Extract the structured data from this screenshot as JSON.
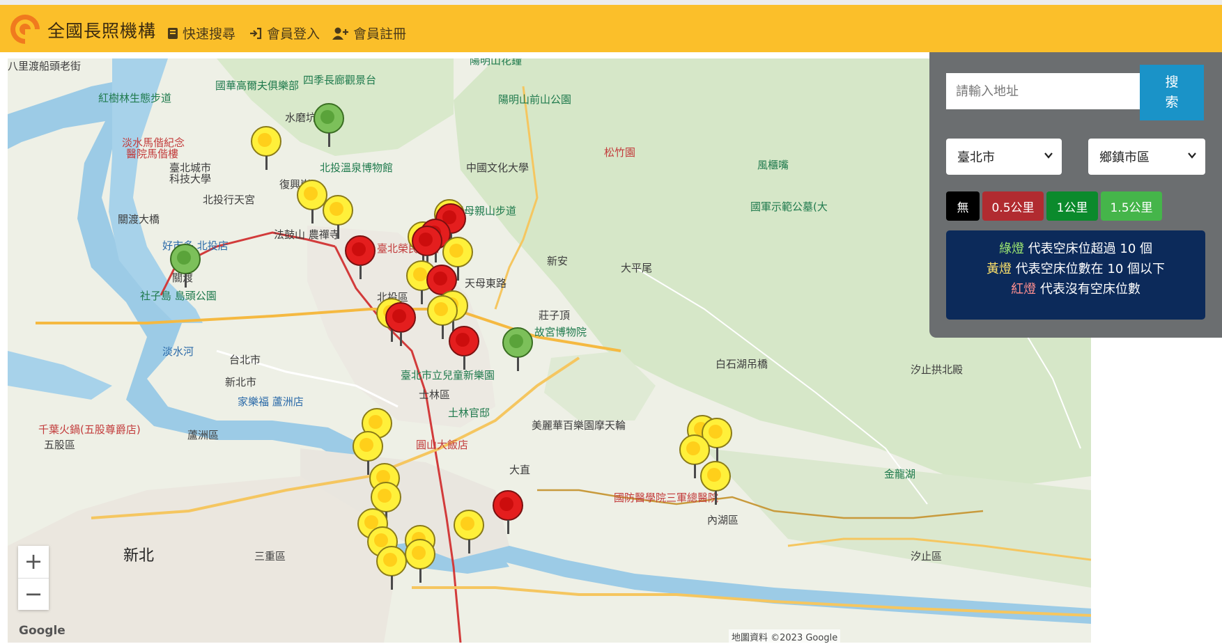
{
  "navbar": {
    "brand": "全國長照機構",
    "links": [
      {
        "label": "快速搜尋",
        "icon": "book-icon"
      },
      {
        "label": "會員登入",
        "icon": "sign-in-icon"
      },
      {
        "label": "會員註冊",
        "icon": "user-plus-icon"
      }
    ]
  },
  "search": {
    "placeholder": "請輸入地址",
    "button_line1": "搜",
    "button_line2": "索",
    "city": "臺北市",
    "district": "鄉鎮市區",
    "radius_buttons": [
      "無",
      "0.5公里",
      "1公里",
      "1.5公里"
    ],
    "colors": {
      "none": "#000000",
      "half": "#b12b30",
      "one": "#0b8a2c",
      "onehalf": "#45b54a"
    }
  },
  "legend": {
    "green_word": "綠燈",
    "green_text": " 代表空床位超過 10 個",
    "yellow_word": "黃燈",
    "yellow_text": " 代表空床位數在 10 個以下",
    "red_word": "紅燈",
    "red_text": " 代表沒有空床位數"
  },
  "map": {
    "zoom_in": "+",
    "zoom_out": "−",
    "google": "Google",
    "attribution": "地圖資料 ©2023 Google",
    "labels": {
      "l1": "八里渡船頭老街",
      "l2": "紅樹林生態步道",
      "l3": "國華高爾夫俱樂部",
      "l4": "四季長廊觀景台",
      "l5": "陽明山花鐘",
      "l6": "陽明山前山公園",
      "l7": "淡水馬偕紀念",
      "l8": "醫院馬偕樓",
      "l9": "臺北城市",
      "l10": "科技大學",
      "l11": "北投行天宮",
      "l12": "北投溫泉博物館",
      "l13": "中國文化大學",
      "l14": "天母親山步道",
      "l15": "松竹園",
      "l16": "風櫃嘴",
      "l17": "國軍示範公墓(大",
      "l18": "關渡大橋",
      "l19": "好市多 北投店",
      "l20": "法鼓山 農禪寺",
      "l21": "臺北榮民總醫",
      "l22": "北投區",
      "l23": "故宮博物院",
      "l24": "社子島 島頭公園",
      "l25": "臺北市立兒童新樂園",
      "l26": "士林區",
      "l27": "土林官邸",
      "l28": "美麗華百樂園摩天輪",
      "l29": "白石湖吊橋",
      "l30": "家樂福 蘆洲店",
      "l31": "千葉火鍋(五股尊爵店)",
      "l32": "五股區",
      "l33": "蘆洲區",
      "l34": "圓山大飯店",
      "l35": "國防醫學院三軍總醫院",
      "l36": "內湖區",
      "l37": "三重區",
      "l38": "新北",
      "l39": "台北市",
      "l40": "新北市",
      "l41": "汐止拱北殿",
      "l42": "金龍湖",
      "l43": "汐止區",
      "l44": "大直",
      "l45": "復興崗",
      "l46": "水磨坑",
      "l47": "天母東路",
      "l48": "大平尾",
      "l49": "莊子頂",
      "l50": "新安",
      "l51": "關渡",
      "l52": "淡水河"
    }
  }
}
